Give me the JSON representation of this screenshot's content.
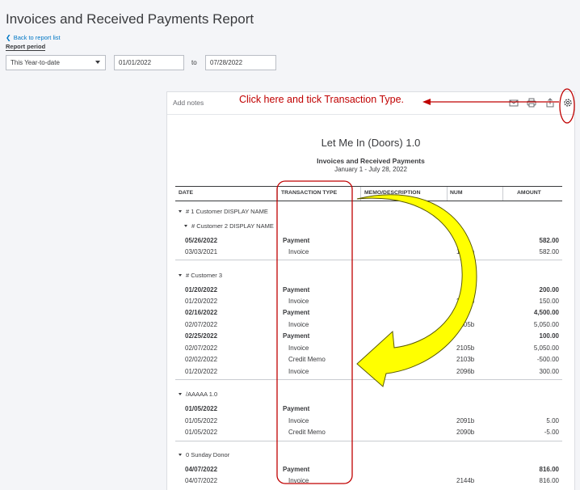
{
  "header": {
    "title": "Invoices and Received Payments Report",
    "back_link": "Back to report list",
    "period_label": "Report period",
    "period_select": "This Year-to-date",
    "date_from": "01/01/2022",
    "to_label": "to",
    "date_to": "07/28/2022"
  },
  "toolbar": {
    "add_notes": "Add notes",
    "icons": [
      "email-icon",
      "print-icon",
      "export-icon",
      "gear-icon"
    ]
  },
  "report": {
    "company": "Let Me In (Doors) 1.0",
    "name": "Invoices and Received Payments",
    "range": "January 1 - July 28, 2022",
    "columns": [
      "DATE",
      "TRANSACTION TYPE",
      "MEMO/DESCRIPTION",
      "NUM",
      "AMOUNT"
    ],
    "groups": [
      {
        "name": "# 1 Customer DISPLAY NAME",
        "subgroup": "# Customer 2 DISPLAY NAME",
        "rows": [
          {
            "date": "05/26/2022",
            "type": "Payment",
            "num": "",
            "amount": "582.00",
            "bold": true
          },
          {
            "date": "03/03/2021",
            "type": "Invoice",
            "num": "1982b",
            "amount": "582.00",
            "bold": false
          }
        ]
      },
      {
        "name": "# Customer 3",
        "rows": [
          {
            "date": "01/20/2022",
            "type": "Payment",
            "num": "",
            "amount": "200.00",
            "bold": true
          },
          {
            "date": "01/20/2022",
            "type": "Invoice",
            "num": "2095b",
            "amount": "150.00",
            "bold": false
          },
          {
            "date": "02/16/2022",
            "type": "Payment",
            "num": "",
            "amount": "4,500.00",
            "bold": true
          },
          {
            "date": "02/07/2022",
            "type": "Invoice",
            "num": "2105b",
            "amount": "5,050.00",
            "bold": false
          },
          {
            "date": "02/25/2022",
            "type": "Payment",
            "num": "",
            "amount": "100.00",
            "bold": true
          },
          {
            "date": "02/07/2022",
            "type": "Invoice",
            "num": "2105b",
            "amount": "5,050.00",
            "bold": false
          },
          {
            "date": "02/02/2022",
            "type": "Credit Memo",
            "num": "2103b",
            "amount": "-500.00",
            "bold": false
          },
          {
            "date": "01/20/2022",
            "type": "Invoice",
            "num": "2096b",
            "amount": "300.00",
            "bold": false
          }
        ]
      },
      {
        "name": "/AAAAA 1.0",
        "rows": [
          {
            "date": "01/05/2022",
            "type": "Payment",
            "num": "",
            "amount": "",
            "bold": true
          },
          {
            "date": "01/05/2022",
            "type": "Invoice",
            "num": "2091b",
            "amount": "5.00",
            "bold": false
          },
          {
            "date": "01/05/2022",
            "type": "Credit Memo",
            "num": "2090b",
            "amount": "-5.00",
            "bold": false
          }
        ]
      },
      {
        "name": "0 Sunday Donor",
        "rows": [
          {
            "date": "04/07/2022",
            "type": "Payment",
            "num": "",
            "amount": "816.00",
            "bold": true
          },
          {
            "date": "04/07/2022",
            "type": "Invoice",
            "num": "2144b",
            "amount": "816.00",
            "bold": false
          }
        ]
      }
    ]
  },
  "annotation": {
    "callout": "Click here and tick Transaction Type.",
    "color_red": "#c00000",
    "color_arrow": "#ffff00"
  }
}
